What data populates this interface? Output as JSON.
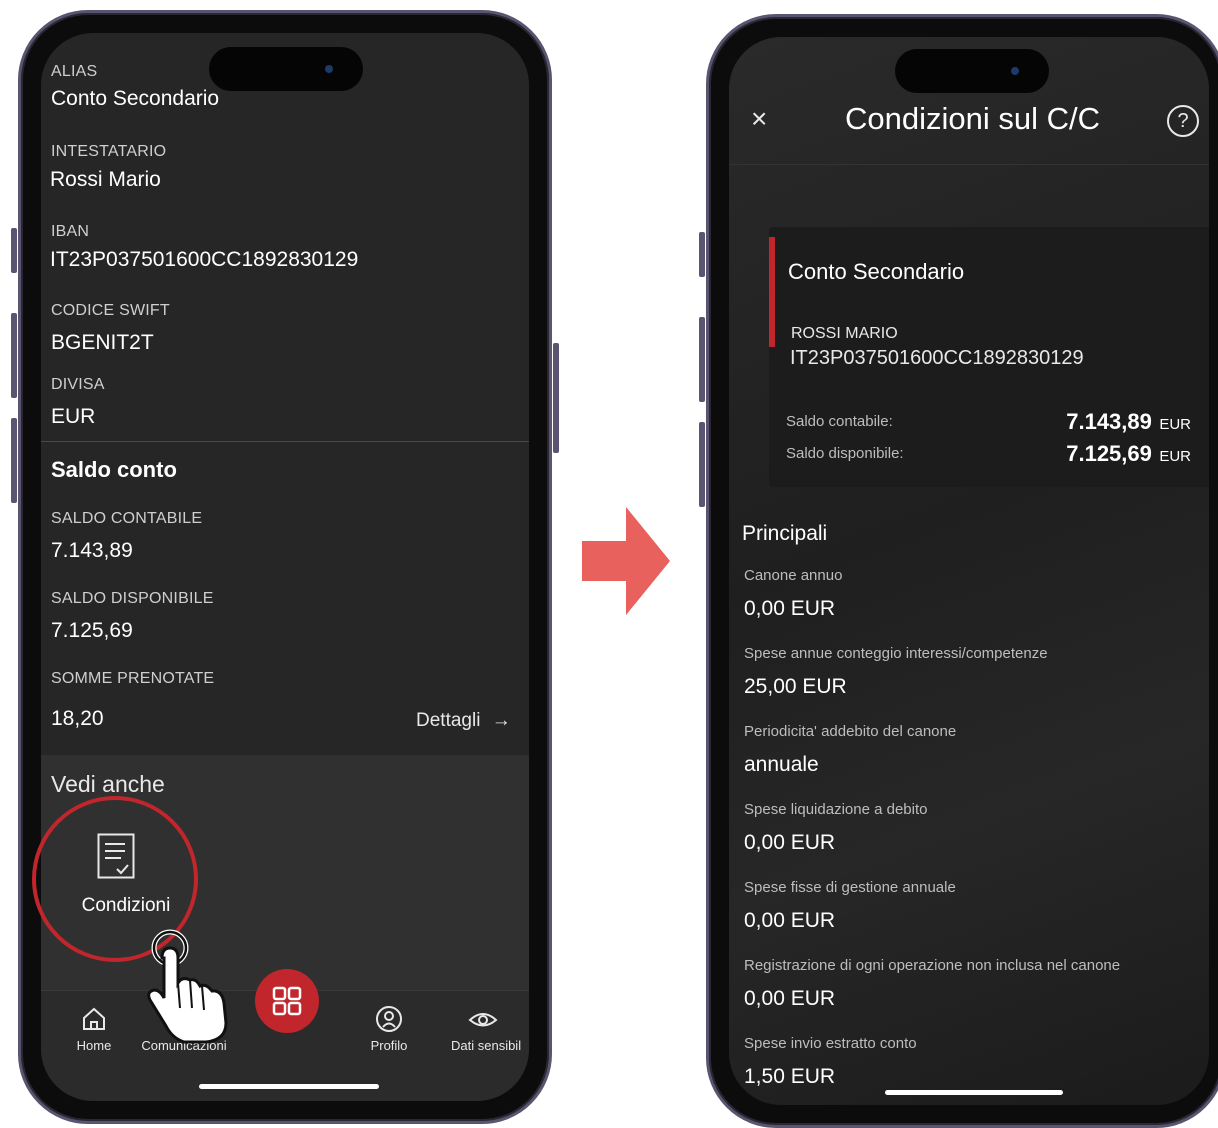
{
  "left": {
    "fields": [
      {
        "label": "ALIAS",
        "value": "Conto Secondario"
      },
      {
        "label": "INTESTATARIO",
        "value": "Rossi Mario"
      },
      {
        "label": "IBAN",
        "value": "IT23P037501600CC1892830129"
      },
      {
        "label": "CODICE SWIFT",
        "value": "BGENIT2T"
      },
      {
        "label": "DIVISA",
        "value": "EUR"
      }
    ],
    "saldo_title": "Saldo conto",
    "saldo": [
      {
        "label": "SALDO CONTABILE",
        "value": "7.143,89"
      },
      {
        "label": "SALDO DISPONIBILE",
        "value": "7.125,69"
      },
      {
        "label": "SOMME PRENOTATE",
        "value": "18,20"
      }
    ],
    "details_link": "Dettagli",
    "details_arrow": "→",
    "see_also_title": "Vedi anche",
    "conditions_label": "Condizioni",
    "highlight_color": "#c0262c",
    "tabs": [
      {
        "label": "Home",
        "icon": "home-icon"
      },
      {
        "label": "Comunicazioni",
        "icon": "mail-icon"
      },
      {
        "label": "",
        "icon": "grid-menu-icon"
      },
      {
        "label": "Profilo",
        "icon": "profile-icon"
      },
      {
        "label": "Dati sensibil",
        "icon": "eye-icon"
      }
    ],
    "center_button_color": "#c0262c"
  },
  "right": {
    "header": {
      "title": "Condizioni sul C/C",
      "close": "×",
      "help": "?"
    },
    "card": {
      "alias": "Conto Secondario",
      "holder": "ROSSI MARIO",
      "iban": "IT23P037501600CC1892830129",
      "saldo_contabile_label": "Saldo contabile:",
      "saldo_contabile_value": "7.143,89",
      "saldo_disponibile_label": "Saldo disponibile:",
      "saldo_disponibile_value": "7.125,69",
      "currency": "EUR",
      "accent_color": "#c0262c"
    },
    "section_title": "Principali",
    "conditions": [
      {
        "label": "Canone annuo",
        "value": "0,00 EUR"
      },
      {
        "label": "Spese annue conteggio interessi/competenze",
        "value": "25,00 EUR"
      },
      {
        "label": "Periodicita' addebito del canone",
        "value": "annuale"
      },
      {
        "label": "Spese liquidazione a debito",
        "value": "0,00 EUR"
      },
      {
        "label": "Spese fisse di gestione annuale",
        "value": "0,00 EUR"
      },
      {
        "label": "Registrazione di ogni operazione non inclusa nel canone",
        "value": "0,00 EUR"
      },
      {
        "label": "Spese invio estratto conto",
        "value": "1,50 EUR"
      }
    ]
  },
  "arrow_color": "#e8615c"
}
